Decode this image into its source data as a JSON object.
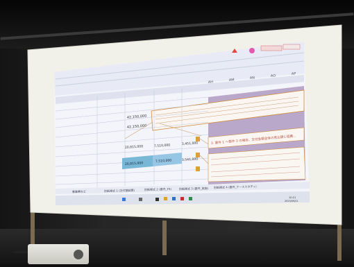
{
  "scene": {
    "description_colors": {
      "screen_bg": "#f4f4ee",
      "projected_sheet": "#f2f3f8",
      "ribbon": "#e9ecf5",
      "header_band": "#b7a7c9",
      "highlight_cell": "#7fb3d9",
      "orange_accent": "#d9a13a",
      "taskbar": "#dfe3ec"
    }
  },
  "spreadsheet": {
    "amount_1": "42,150,000",
    "amount_2": "42,150,000",
    "amount_3": "20,815,000",
    "amount_4": "7,510,000",
    "amount_5": "3,451,000",
    "amount_6": "20,815,000",
    "amount_7": "7,510,000",
    "amount_8": "3,541,000",
    "callout_title": "3. 要件 1 ～要件 3 の場合、交付金額全体の見込額と経費…",
    "col_headers": [
      "AH",
      "AM",
      "AN",
      "AO",
      "AP"
    ],
    "tabs": [
      "事業費など",
      "別紙様式 1 (交付額試算)",
      "別紙様式 2 (要件_FS)",
      "別紙様式 3 (要件_実施)",
      "別紙様式 4 (要件_ケーススタディ)"
    ]
  },
  "taskbar": {
    "time": "10:21",
    "date": "2023/09/21"
  }
}
